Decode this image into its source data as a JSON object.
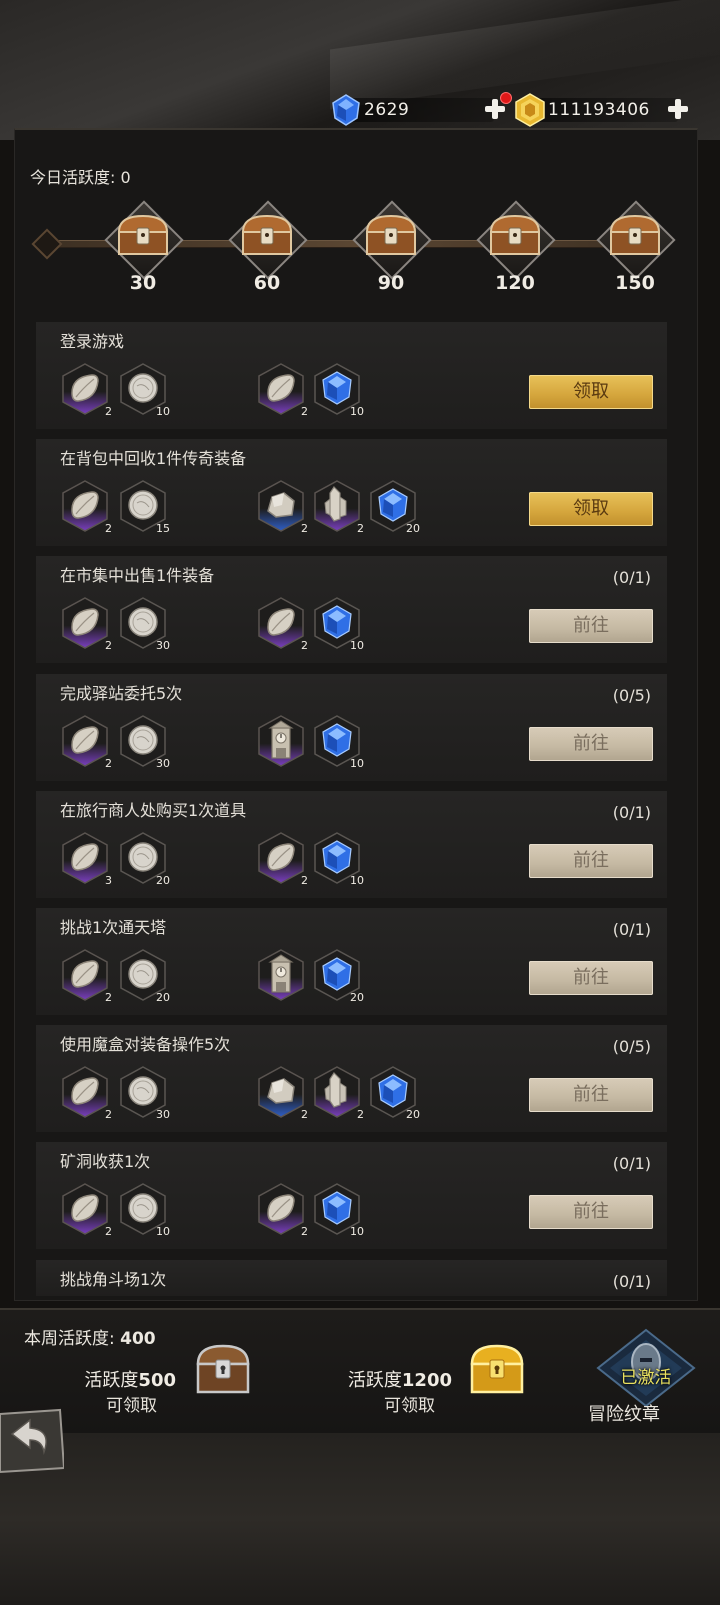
{
  "currency": {
    "gems": "2629",
    "gold": "111193406"
  },
  "today": {
    "label": "今日活跃度:",
    "value": "0"
  },
  "milestones": [
    "30",
    "60",
    "90",
    "120",
    "150"
  ],
  "tasks": [
    {
      "title": "登录游戏",
      "progress": "",
      "button": "领取",
      "state": "claim",
      "items_a": [
        {
          "icon": "leaf-stone",
          "count": "2",
          "frame": "purple"
        },
        {
          "icon": "silver-coin",
          "count": "10",
          "frame": "plain"
        }
      ],
      "items_b": [
        {
          "icon": "leaf-stone",
          "count": "2",
          "frame": "purple"
        },
        {
          "icon": "blue-gem",
          "count": "10",
          "frame": "plain"
        }
      ]
    },
    {
      "title": "在背包中回收1件传奇装备",
      "progress": "",
      "button": "领取",
      "state": "claim",
      "items_a": [
        {
          "icon": "leaf-stone",
          "count": "2",
          "frame": "purple"
        },
        {
          "icon": "silver-coin",
          "count": "15",
          "frame": "plain"
        }
      ],
      "items_b": [
        {
          "icon": "ore-rock",
          "count": "2",
          "frame": "blue"
        },
        {
          "icon": "crystal-shard",
          "count": "2",
          "frame": "purple"
        },
        {
          "icon": "blue-gem",
          "count": "20",
          "frame": "plain"
        }
      ]
    },
    {
      "title": "在市集中出售1件装备",
      "progress": "(0/1)",
      "button": "前往",
      "state": "go",
      "items_a": [
        {
          "icon": "leaf-stone",
          "count": "2",
          "frame": "purple"
        },
        {
          "icon": "silver-coin",
          "count": "30",
          "frame": "plain"
        }
      ],
      "items_b": [
        {
          "icon": "leaf-stone",
          "count": "2",
          "frame": "purple"
        },
        {
          "icon": "blue-gem",
          "count": "10",
          "frame": "plain"
        }
      ]
    },
    {
      "title": "完成驿站委托5次",
      "progress": "(0/5)",
      "button": "前往",
      "state": "go",
      "items_a": [
        {
          "icon": "leaf-stone",
          "count": "2",
          "frame": "purple"
        },
        {
          "icon": "silver-coin",
          "count": "30",
          "frame": "plain"
        }
      ],
      "items_b": [
        {
          "icon": "clock-tower",
          "count": "",
          "frame": "purple"
        },
        {
          "icon": "blue-gem",
          "count": "10",
          "frame": "plain"
        }
      ]
    },
    {
      "title": "在旅行商人处购买1次道具",
      "progress": "(0/1)",
      "button": "前往",
      "state": "go",
      "items_a": [
        {
          "icon": "leaf-stone",
          "count": "3",
          "frame": "purple"
        },
        {
          "icon": "silver-coin",
          "count": "20",
          "frame": "plain"
        }
      ],
      "items_b": [
        {
          "icon": "leaf-stone",
          "count": "2",
          "frame": "purple"
        },
        {
          "icon": "blue-gem",
          "count": "10",
          "frame": "plain"
        }
      ]
    },
    {
      "title": "挑战1次通天塔",
      "progress": "(0/1)",
      "button": "前往",
      "state": "go",
      "items_a": [
        {
          "icon": "leaf-stone",
          "count": "2",
          "frame": "purple"
        },
        {
          "icon": "silver-coin",
          "count": "20",
          "frame": "plain"
        }
      ],
      "items_b": [
        {
          "icon": "clock-tower",
          "count": "",
          "frame": "purple"
        },
        {
          "icon": "blue-gem",
          "count": "20",
          "frame": "plain"
        }
      ]
    },
    {
      "title": "使用魔盒对装备操作5次",
      "progress": "(0/5)",
      "button": "前往",
      "state": "go",
      "items_a": [
        {
          "icon": "leaf-stone",
          "count": "2",
          "frame": "purple"
        },
        {
          "icon": "silver-coin",
          "count": "30",
          "frame": "plain"
        }
      ],
      "items_b": [
        {
          "icon": "ore-rock",
          "count": "2",
          "frame": "blue"
        },
        {
          "icon": "crystal-shard",
          "count": "2",
          "frame": "purple"
        },
        {
          "icon": "blue-gem",
          "count": "20",
          "frame": "plain"
        }
      ]
    },
    {
      "title": "矿洞收获1次",
      "progress": "(0/1)",
      "button": "前往",
      "state": "go",
      "items_a": [
        {
          "icon": "leaf-stone",
          "count": "2",
          "frame": "purple"
        },
        {
          "icon": "silver-coin",
          "count": "10",
          "frame": "plain"
        }
      ],
      "items_b": [
        {
          "icon": "leaf-stone",
          "count": "2",
          "frame": "purple"
        },
        {
          "icon": "blue-gem",
          "count": "10",
          "frame": "plain"
        }
      ]
    },
    {
      "title": "挑战角斗场1次",
      "progress": "(0/1)",
      "button": "",
      "state": "partial",
      "items_a": [],
      "items_b": []
    }
  ],
  "weekly": {
    "label": "本周活跃度:",
    "value": "400",
    "reward1_label": "活跃度",
    "reward1_value": "500",
    "reward1_sub": "可领取",
    "reward2_label": "活跃度",
    "reward2_value": "1200",
    "reward2_sub": "可领取"
  },
  "badge": {
    "status": "已激活",
    "label": "冒险纹章"
  },
  "colors": {
    "claim_button": "#d4a53c",
    "go_button": "#c4b8a2",
    "purple_frame": "#7a3fc0",
    "blue_gem": "#3a7ef0"
  }
}
